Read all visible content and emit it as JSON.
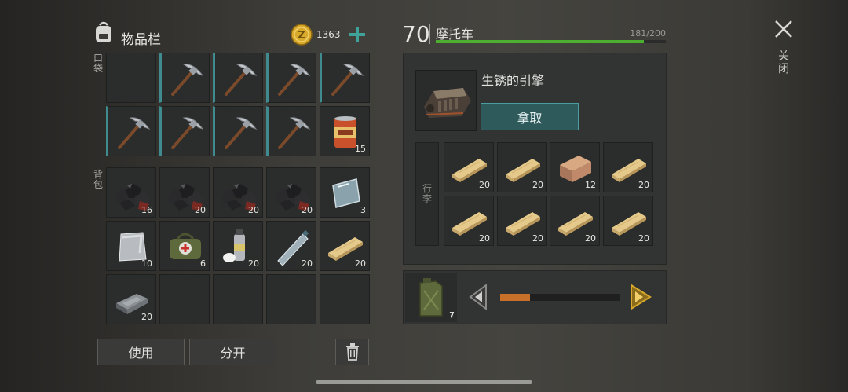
{
  "inventory": {
    "title": "物品栏",
    "coins": "1363",
    "pocket_label": "口袋",
    "backpack_label": "背包",
    "pocket_slots": [
      {
        "icon": "empty",
        "count": ""
      },
      {
        "icon": "pickaxe-icon",
        "count": ""
      },
      {
        "icon": "pickaxe-icon",
        "count": ""
      },
      {
        "icon": "pickaxe-icon",
        "count": ""
      },
      {
        "icon": "pickaxe-icon",
        "count": ""
      },
      {
        "icon": "pickaxe-icon",
        "count": ""
      },
      {
        "icon": "pickaxe-icon",
        "count": ""
      },
      {
        "icon": "pickaxe-icon",
        "count": ""
      },
      {
        "icon": "pickaxe-icon",
        "count": ""
      },
      {
        "icon": "canned-food-icon",
        "count": "15"
      }
    ],
    "backpack_slots": [
      {
        "icon": "coal-icon",
        "count": "16"
      },
      {
        "icon": "coal-icon",
        "count": "20"
      },
      {
        "icon": "coal-icon",
        "count": "20"
      },
      {
        "icon": "coal-icon",
        "count": "20"
      },
      {
        "icon": "glass-pane-icon",
        "count": "3"
      },
      {
        "icon": "metal-sheet-icon",
        "count": "10"
      },
      {
        "icon": "medical-bag-icon",
        "count": "6"
      },
      {
        "icon": "spray-can-icon",
        "count": "20"
      },
      {
        "icon": "plastic-bottle-icon",
        "count": "20"
      },
      {
        "icon": "wood-plank-icon",
        "count": "20"
      },
      {
        "icon": "iron-ingot-icon",
        "count": "20"
      },
      {
        "icon": "empty",
        "count": ""
      },
      {
        "icon": "empty",
        "count": ""
      },
      {
        "icon": "empty",
        "count": ""
      },
      {
        "icon": "empty",
        "count": ""
      }
    ],
    "use_label": "使用",
    "split_label": "分开"
  },
  "vehicle": {
    "level": "70",
    "name": "摩托车",
    "durability": "181/200",
    "durability_fraction": 0.905,
    "part_name": "生锈的引擎",
    "take_label": "拿取",
    "luggage_label": "行李",
    "luggage_slots": [
      {
        "icon": "wood-plank-icon",
        "count": "20"
      },
      {
        "icon": "wood-plank-icon",
        "count": "20"
      },
      {
        "icon": "wood-block-icon",
        "count": "12"
      },
      {
        "icon": "wood-plank-icon",
        "count": "20"
      },
      {
        "icon": "wood-plank-icon",
        "count": "20"
      },
      {
        "icon": "wood-plank-icon",
        "count": "20"
      },
      {
        "icon": "wood-plank-icon",
        "count": "20"
      },
      {
        "icon": "wood-plank-icon",
        "count": "20"
      }
    ],
    "fuel_count": "7",
    "fuel_fraction": 0.25
  },
  "close_label": "关闭",
  "colors": {
    "accent": "#3f8b8f",
    "durability": "#4caf2f",
    "fuel": "#c8702a",
    "coin": "#d8a92a"
  }
}
